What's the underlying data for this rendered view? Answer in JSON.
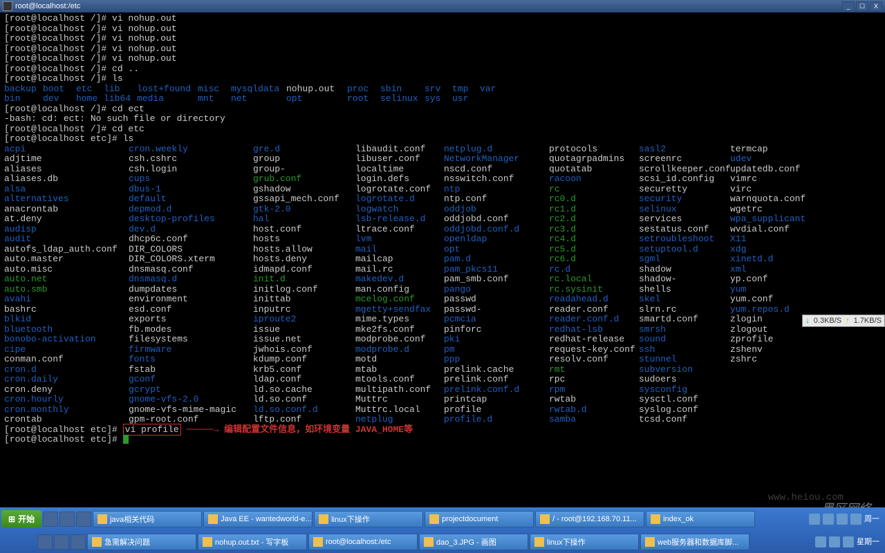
{
  "window": {
    "title": "root@localhost:/etc"
  },
  "win_btns": {
    "min": "_",
    "max": "☐",
    "close": "X"
  },
  "history": [
    "[root@localhost /]# vi nohup.out",
    "[root@localhost /]# vi nohup.out",
    "[root@localhost /]# vi nohup.out",
    "[root@localhost /]# vi nohup.out",
    "[root@localhost /]# vi nohup.out",
    "[root@localhost /]# cd ..",
    "[root@localhost /]# ls"
  ],
  "ls_root_row1": [
    {
      "t": "backup",
      "c": "dir"
    },
    {
      "t": "boot",
      "c": "dir"
    },
    {
      "t": "etc",
      "c": "dir"
    },
    {
      "t": "lib",
      "c": "dir"
    },
    {
      "t": "lost+found",
      "c": "dir"
    },
    {
      "t": "misc",
      "c": "dir"
    },
    {
      "t": "mysqldata",
      "c": "dir"
    },
    {
      "t": "nohup.out",
      "c": ""
    },
    {
      "t": "proc",
      "c": "dir"
    },
    {
      "t": "sbin",
      "c": "dir"
    },
    {
      "t": "srv",
      "c": "dir"
    },
    {
      "t": "tmp",
      "c": "dir"
    },
    {
      "t": "var",
      "c": "dir"
    }
  ],
  "ls_root_row2": [
    {
      "t": "bin",
      "c": "dir"
    },
    {
      "t": "dev",
      "c": "dir"
    },
    {
      "t": "home",
      "c": "dir"
    },
    {
      "t": "lib64",
      "c": "dir"
    },
    {
      "t": "media",
      "c": "dir"
    },
    {
      "t": "mnt",
      "c": "dir"
    },
    {
      "t": "net",
      "c": "dir"
    },
    {
      "t": "opt",
      "c": "dir"
    },
    {
      "t": "root",
      "c": "dir"
    },
    {
      "t": "selinux",
      "c": "dir"
    },
    {
      "t": "sys",
      "c": "dir"
    },
    {
      "t": "usr",
      "c": "dir"
    }
  ],
  "history2": [
    "[root@localhost /]# cd ect",
    "-bash: cd: ect: No such file or directory",
    "[root@localhost /]# cd etc",
    "[root@localhost etc]# ls"
  ],
  "ls_etc": [
    [
      {
        "t": "acpi",
        "c": "dir"
      },
      {
        "t": "cron.weekly",
        "c": "dir"
      },
      {
        "t": "gre.d",
        "c": "dir"
      },
      {
        "t": "libaudit.conf",
        "c": ""
      },
      {
        "t": "netplug.d",
        "c": "dir"
      },
      {
        "t": "protocols",
        "c": ""
      },
      {
        "t": "sasl2",
        "c": "dir"
      },
      {
        "t": "termcap",
        "c": ""
      }
    ],
    [
      {
        "t": "adjtime",
        "c": ""
      },
      {
        "t": "csh.cshrc",
        "c": ""
      },
      {
        "t": "group",
        "c": ""
      },
      {
        "t": "libuser.conf",
        "c": ""
      },
      {
        "t": "NetworkManager",
        "c": "dir"
      },
      {
        "t": "quotagrpadmins",
        "c": ""
      },
      {
        "t": "screenrc",
        "c": ""
      },
      {
        "t": "udev",
        "c": "dir"
      }
    ],
    [
      {
        "t": "aliases",
        "c": ""
      },
      {
        "t": "csh.login",
        "c": ""
      },
      {
        "t": "group-",
        "c": ""
      },
      {
        "t": "localtime",
        "c": ""
      },
      {
        "t": "nscd.conf",
        "c": ""
      },
      {
        "t": "quotatab",
        "c": ""
      },
      {
        "t": "scrollkeeper.conf",
        "c": ""
      },
      {
        "t": "updatedb.conf",
        "c": ""
      }
    ],
    [
      {
        "t": "aliases.db",
        "c": ""
      },
      {
        "t": "cups",
        "c": "dir"
      },
      {
        "t": "grub.conf",
        "c": "exe"
      },
      {
        "t": "login.defs",
        "c": ""
      },
      {
        "t": "nsswitch.conf",
        "c": ""
      },
      {
        "t": "racoon",
        "c": "dir"
      },
      {
        "t": "scsi_id.config",
        "c": ""
      },
      {
        "t": "vimrc",
        "c": ""
      }
    ],
    [
      {
        "t": "alsa",
        "c": "dir"
      },
      {
        "t": "dbus-1",
        "c": "dir"
      },
      {
        "t": "gshadow",
        "c": ""
      },
      {
        "t": "logrotate.conf",
        "c": ""
      },
      {
        "t": "ntp",
        "c": "dir"
      },
      {
        "t": "rc",
        "c": "exe"
      },
      {
        "t": "securetty",
        "c": ""
      },
      {
        "t": "virc",
        "c": ""
      }
    ],
    [
      {
        "t": "alternatives",
        "c": "dir"
      },
      {
        "t": "default",
        "c": "dir"
      },
      {
        "t": "gssapi_mech.conf",
        "c": ""
      },
      {
        "t": "logrotate.d",
        "c": "dir"
      },
      {
        "t": "ntp.conf",
        "c": ""
      },
      {
        "t": "rc0.d",
        "c": "exe"
      },
      {
        "t": "security",
        "c": "dir"
      },
      {
        "t": "warnquota.conf",
        "c": ""
      }
    ],
    [
      {
        "t": "anacrontab",
        "c": ""
      },
      {
        "t": "depmod.d",
        "c": "dir"
      },
      {
        "t": "gtk-2.0",
        "c": "dir"
      },
      {
        "t": "logwatch",
        "c": "dir"
      },
      {
        "t": "oddjob",
        "c": "dir"
      },
      {
        "t": "rc1.d",
        "c": "exe"
      },
      {
        "t": "selinux",
        "c": "dir"
      },
      {
        "t": "wgetrc",
        "c": ""
      }
    ],
    [
      {
        "t": "at.deny",
        "c": ""
      },
      {
        "t": "desktop-profiles",
        "c": "dir"
      },
      {
        "t": "hal",
        "c": "dir"
      },
      {
        "t": "lsb-release.d",
        "c": "dir"
      },
      {
        "t": "oddjobd.conf",
        "c": ""
      },
      {
        "t": "rc2.d",
        "c": "exe"
      },
      {
        "t": "services",
        "c": ""
      },
      {
        "t": "wpa_supplicant",
        "c": "dir"
      }
    ],
    [
      {
        "t": "audisp",
        "c": "dir"
      },
      {
        "t": "dev.d",
        "c": "dir"
      },
      {
        "t": "host.conf",
        "c": ""
      },
      {
        "t": "ltrace.conf",
        "c": ""
      },
      {
        "t": "oddjobd.conf.d",
        "c": "dir"
      },
      {
        "t": "rc3.d",
        "c": "exe"
      },
      {
        "t": "sestatus.conf",
        "c": ""
      },
      {
        "t": "wvdial.conf",
        "c": ""
      }
    ],
    [
      {
        "t": "audit",
        "c": "dir"
      },
      {
        "t": "dhcp6c.conf",
        "c": ""
      },
      {
        "t": "hosts",
        "c": ""
      },
      {
        "t": "lvm",
        "c": "dir"
      },
      {
        "t": "openldap",
        "c": "dir"
      },
      {
        "t": "rc4.d",
        "c": "exe"
      },
      {
        "t": "setroubleshoot",
        "c": "dir"
      },
      {
        "t": "X11",
        "c": "dir"
      }
    ],
    [
      {
        "t": "autofs_ldap_auth.conf",
        "c": ""
      },
      {
        "t": "DIR_COLORS",
        "c": ""
      },
      {
        "t": "hosts.allow",
        "c": ""
      },
      {
        "t": "mail",
        "c": "dir"
      },
      {
        "t": "opt",
        "c": "dir"
      },
      {
        "t": "rc5.d",
        "c": "exe"
      },
      {
        "t": "setuptool.d",
        "c": "dir"
      },
      {
        "t": "xdg",
        "c": "dir"
      }
    ],
    [
      {
        "t": "auto.master",
        "c": ""
      },
      {
        "t": "DIR_COLORS.xterm",
        "c": ""
      },
      {
        "t": "hosts.deny",
        "c": ""
      },
      {
        "t": "mailcap",
        "c": ""
      },
      {
        "t": "pam.d",
        "c": "dir"
      },
      {
        "t": "rc6.d",
        "c": "exe"
      },
      {
        "t": "sgml",
        "c": "dir"
      },
      {
        "t": "xinetd.d",
        "c": "dir"
      }
    ],
    [
      {
        "t": "auto.misc",
        "c": ""
      },
      {
        "t": "dnsmasq.conf",
        "c": ""
      },
      {
        "t": "idmapd.conf",
        "c": ""
      },
      {
        "t": "mail.rc",
        "c": ""
      },
      {
        "t": "pam_pkcs11",
        "c": "dir"
      },
      {
        "t": "rc.d",
        "c": "dir"
      },
      {
        "t": "shadow",
        "c": ""
      },
      {
        "t": "xml",
        "c": "dir"
      }
    ],
    [
      {
        "t": "auto.net",
        "c": "exe"
      },
      {
        "t": "dnsmasq.d",
        "c": "dir"
      },
      {
        "t": "init.d",
        "c": "exe"
      },
      {
        "t": "makedev.d",
        "c": "dir"
      },
      {
        "t": "pam_smb.conf",
        "c": ""
      },
      {
        "t": "rc.local",
        "c": "exe"
      },
      {
        "t": "shadow-",
        "c": ""
      },
      {
        "t": "yp.conf",
        "c": ""
      }
    ],
    [
      {
        "t": "auto.smb",
        "c": "exe"
      },
      {
        "t": "dumpdates",
        "c": ""
      },
      {
        "t": "initlog.conf",
        "c": ""
      },
      {
        "t": "man.config",
        "c": ""
      },
      {
        "t": "pango",
        "c": "dir"
      },
      {
        "t": "rc.sysinit",
        "c": "exe"
      },
      {
        "t": "shells",
        "c": ""
      },
      {
        "t": "yum",
        "c": "dir"
      }
    ],
    [
      {
        "t": "avahi",
        "c": "dir"
      },
      {
        "t": "environment",
        "c": ""
      },
      {
        "t": "inittab",
        "c": ""
      },
      {
        "t": "mcelog.conf",
        "c": "exe"
      },
      {
        "t": "passwd",
        "c": ""
      },
      {
        "t": "readahead.d",
        "c": "dir"
      },
      {
        "t": "skel",
        "c": "dir"
      },
      {
        "t": "yum.conf",
        "c": ""
      }
    ],
    [
      {
        "t": "bashrc",
        "c": ""
      },
      {
        "t": "esd.conf",
        "c": ""
      },
      {
        "t": "inputrc",
        "c": ""
      },
      {
        "t": "mgetty+sendfax",
        "c": "dir"
      },
      {
        "t": "passwd-",
        "c": ""
      },
      {
        "t": "reader.conf",
        "c": ""
      },
      {
        "t": "slrn.rc",
        "c": ""
      },
      {
        "t": "yum.repos.d",
        "c": "dir"
      }
    ],
    [
      {
        "t": "blkid",
        "c": "dir"
      },
      {
        "t": "exports",
        "c": ""
      },
      {
        "t": "iproute2",
        "c": "dir"
      },
      {
        "t": "mime.types",
        "c": ""
      },
      {
        "t": "pcmcia",
        "c": "dir"
      },
      {
        "t": "reader.conf.d",
        "c": "dir"
      },
      {
        "t": "smartd.conf",
        "c": ""
      },
      {
        "t": "zlogin",
        "c": ""
      }
    ],
    [
      {
        "t": "bluetooth",
        "c": "dir"
      },
      {
        "t": "fb.modes",
        "c": ""
      },
      {
        "t": "issue",
        "c": ""
      },
      {
        "t": "mke2fs.conf",
        "c": ""
      },
      {
        "t": "pinforc",
        "c": ""
      },
      {
        "t": "redhat-lsb",
        "c": "dir"
      },
      {
        "t": "smrsh",
        "c": "dir"
      },
      {
        "t": "zlogout",
        "c": ""
      }
    ],
    [
      {
        "t": "bonobo-activation",
        "c": "dir"
      },
      {
        "t": "filesystems",
        "c": ""
      },
      {
        "t": "issue.net",
        "c": ""
      },
      {
        "t": "modprobe.conf",
        "c": ""
      },
      {
        "t": "pki",
        "c": "dir"
      },
      {
        "t": "redhat-release",
        "c": ""
      },
      {
        "t": "sound",
        "c": "dir"
      },
      {
        "t": "zprofile",
        "c": ""
      }
    ],
    [
      {
        "t": "cipe",
        "c": "dir"
      },
      {
        "t": "firmware",
        "c": "dir"
      },
      {
        "t": "jwhois.conf",
        "c": ""
      },
      {
        "t": "modprobe.d",
        "c": "dir"
      },
      {
        "t": "pm",
        "c": "dir"
      },
      {
        "t": "request-key.conf",
        "c": ""
      },
      {
        "t": "ssh",
        "c": "dir"
      },
      {
        "t": "zshenv",
        "c": ""
      }
    ],
    [
      {
        "t": "conman.conf",
        "c": ""
      },
      {
        "t": "fonts",
        "c": "dir"
      },
      {
        "t": "kdump.conf",
        "c": ""
      },
      {
        "t": "motd",
        "c": ""
      },
      {
        "t": "ppp",
        "c": "dir"
      },
      {
        "t": "resolv.conf",
        "c": ""
      },
      {
        "t": "stunnel",
        "c": "dir"
      },
      {
        "t": "zshrc",
        "c": ""
      }
    ],
    [
      {
        "t": "cron.d",
        "c": "dir"
      },
      {
        "t": "fstab",
        "c": ""
      },
      {
        "t": "krb5.conf",
        "c": ""
      },
      {
        "t": "mtab",
        "c": ""
      },
      {
        "t": "prelink.cache",
        "c": ""
      },
      {
        "t": "rmt",
        "c": "exe"
      },
      {
        "t": "subversion",
        "c": "dir"
      },
      {
        "t": "",
        "c": ""
      }
    ],
    [
      {
        "t": "cron.daily",
        "c": "dir"
      },
      {
        "t": "gconf",
        "c": "dir"
      },
      {
        "t": "ldap.conf",
        "c": ""
      },
      {
        "t": "mtools.conf",
        "c": ""
      },
      {
        "t": "prelink.conf",
        "c": ""
      },
      {
        "t": "rpc",
        "c": ""
      },
      {
        "t": "sudoers",
        "c": ""
      },
      {
        "t": "",
        "c": ""
      }
    ],
    [
      {
        "t": "cron.deny",
        "c": ""
      },
      {
        "t": "gcrypt",
        "c": "dir"
      },
      {
        "t": "ld.so.cache",
        "c": ""
      },
      {
        "t": "multipath.conf",
        "c": ""
      },
      {
        "t": "prelink.conf.d",
        "c": "dir"
      },
      {
        "t": "rpm",
        "c": "dir"
      },
      {
        "t": "sysconfig",
        "c": "dir"
      },
      {
        "t": "",
        "c": ""
      }
    ],
    [
      {
        "t": "cron.hourly",
        "c": "dir"
      },
      {
        "t": "gnome-vfs-2.0",
        "c": "dir"
      },
      {
        "t": "ld.so.conf",
        "c": ""
      },
      {
        "t": "Muttrc",
        "c": ""
      },
      {
        "t": "printcap",
        "c": ""
      },
      {
        "t": "rwtab",
        "c": ""
      },
      {
        "t": "sysctl.conf",
        "c": ""
      },
      {
        "t": "",
        "c": ""
      }
    ],
    [
      {
        "t": "cron.monthly",
        "c": "dir"
      },
      {
        "t": "gnome-vfs-mime-magic",
        "c": ""
      },
      {
        "t": "ld.so.conf.d",
        "c": "dir"
      },
      {
        "t": "Muttrc.local",
        "c": ""
      },
      {
        "t": "profile",
        "c": ""
      },
      {
        "t": "rwtab.d",
        "c": "dir"
      },
      {
        "t": "syslog.conf",
        "c": ""
      },
      {
        "t": "",
        "c": ""
      }
    ],
    [
      {
        "t": "crontab",
        "c": ""
      },
      {
        "t": "gpm-root.conf",
        "c": ""
      },
      {
        "t": "lftp.conf",
        "c": ""
      },
      {
        "t": "netplug",
        "c": "dir"
      },
      {
        "t": "profile.d",
        "c": "dir"
      },
      {
        "t": "samba",
        "c": "dir"
      },
      {
        "t": "tcsd.conf",
        "c": ""
      },
      {
        "t": "",
        "c": ""
      }
    ]
  ],
  "prompt_vi": "[root@localhost etc]# ",
  "vi_cmd": "vi profile",
  "arrow": " ─────→ ",
  "annotation": "编辑配置文件信息，如环境变量 JAVA_HOME等",
  "prompt_last": "[root@localhost etc]# ",
  "net": {
    "down": "0.3KB/S",
    "up": "1.7KB/S"
  },
  "start": "开始",
  "tasks_row1": [
    "java相关代码",
    "Java EE - wantedworld-e...",
    "linux下操作",
    "projectdocument",
    "/ - root@192.168.70.11...",
    "index_ok"
  ],
  "tasks_row2": [
    "急需解决问题",
    "nohup.out.txt - 写字板",
    "root@localhost:/etc",
    "dao_3.JPG - 画图",
    "linux下操作",
    "web服务器和数据库脚..."
  ],
  "clock": {
    "time": "周一",
    "date": "星期一"
  },
  "watermark": "黑区网络",
  "watermark2": "www.heiou.com"
}
